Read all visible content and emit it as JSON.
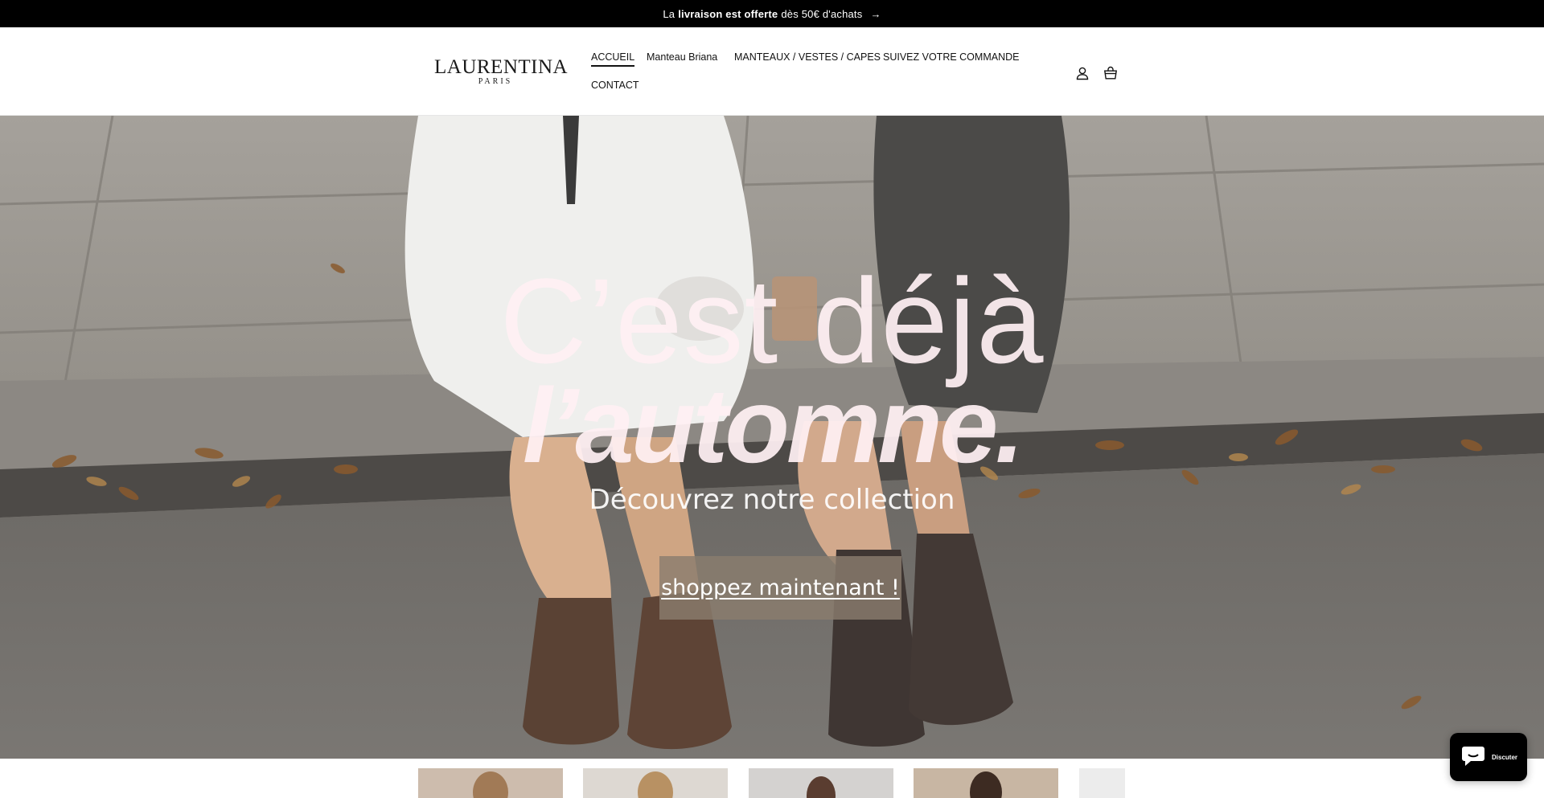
{
  "announcement": {
    "prefix": "La",
    "bold": "livraison est offerte",
    "suffix": "dès 50€ d'achats",
    "arrow": "→"
  },
  "brand": {
    "name": "LAURENTINA",
    "tagline": "PARIS"
  },
  "nav": {
    "items": [
      {
        "label": "ACCUEIL",
        "active": true
      },
      {
        "label": "Manteau Briana",
        "active": false
      },
      {
        "label": "MANTEAUX / VESTES / CAPES",
        "active": false
      },
      {
        "label": "SUIVEZ VOTRE COMMANDE",
        "active": false
      },
      {
        "label": "CONTACT",
        "active": false
      }
    ]
  },
  "header_icons": {
    "account": "account-icon",
    "cart": "cart-icon"
  },
  "hero": {
    "headline_1": "C’est déjà",
    "headline_2": "l’automne.",
    "subheading": "Découvrez notre collection",
    "cta": "shoppez maintenant !"
  },
  "chat": {
    "label": "Discuter",
    "icon": "chat-icon"
  },
  "colors": {
    "announcement_bg": "#000000",
    "header_bg": "#ffffff",
    "hero_text": "#fff0f3",
    "cta_bg": "#8a7c6e"
  }
}
